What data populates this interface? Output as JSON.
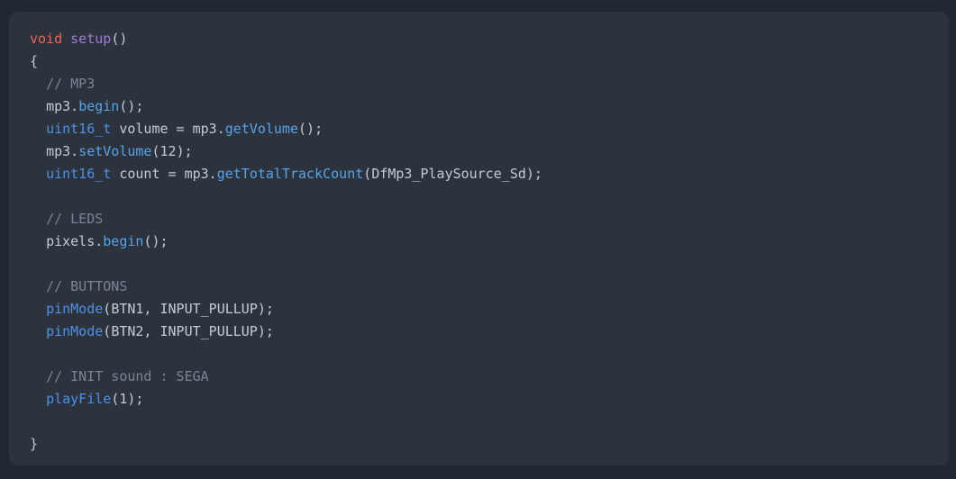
{
  "editor": {
    "background": "#222831",
    "panel_background": "#2d333d",
    "language": "cpp",
    "font_size_px": 15,
    "line_height_px": 25,
    "indent_spaces": 2,
    "colors": {
      "plain": "#c5cbd4",
      "keyword": "#e9645c",
      "type": "#4d91e8",
      "function_definition": "#9b7fd4",
      "function_call": "#4d91e8",
      "method_call": "#56a3ea",
      "comment": "#7a8494",
      "number": "#c5cbd4",
      "punctuation": "#c5cbd4"
    }
  },
  "code": {
    "lines": [
      {
        "number": 1,
        "indent": 0,
        "text": "void setup()",
        "tokens": [
          {
            "text": "void",
            "type": "keyword"
          },
          {
            "text": " ",
            "type": "plain"
          },
          {
            "text": "setup",
            "type": "fndef"
          },
          {
            "text": "()",
            "type": "punct"
          }
        ]
      },
      {
        "number": 2,
        "indent": 0,
        "text": "{",
        "tokens": [
          {
            "text": "{",
            "type": "punct"
          }
        ]
      },
      {
        "number": 3,
        "indent": 2,
        "text": "// MP3",
        "tokens": [
          {
            "text": "// MP3",
            "type": "comment"
          }
        ]
      },
      {
        "number": 4,
        "indent": 2,
        "text": "mp3.begin();",
        "tokens": [
          {
            "text": "mp3.",
            "type": "plain"
          },
          {
            "text": "begin",
            "type": "method"
          },
          {
            "text": "();",
            "type": "punct"
          }
        ]
      },
      {
        "number": 5,
        "indent": 2,
        "text": "uint16_t volume = mp3.getVolume();",
        "tokens": [
          {
            "text": "uint16_t",
            "type": "type"
          },
          {
            "text": " volume = mp3.",
            "type": "plain"
          },
          {
            "text": "getVolume",
            "type": "method"
          },
          {
            "text": "();",
            "type": "punct"
          }
        ]
      },
      {
        "number": 6,
        "indent": 2,
        "text": "mp3.setVolume(12);",
        "tokens": [
          {
            "text": "mp3.",
            "type": "plain"
          },
          {
            "text": "setVolume",
            "type": "method"
          },
          {
            "text": "(",
            "type": "punct"
          },
          {
            "text": "12",
            "type": "num"
          },
          {
            "text": ");",
            "type": "punct"
          }
        ]
      },
      {
        "number": 7,
        "indent": 2,
        "text": "uint16_t count = mp3.getTotalTrackCount(DfMp3_PlaySource_Sd);",
        "tokens": [
          {
            "text": "uint16_t",
            "type": "type"
          },
          {
            "text": " count = mp3.",
            "type": "plain"
          },
          {
            "text": "getTotalTrackCount",
            "type": "method"
          },
          {
            "text": "(",
            "type": "punct"
          },
          {
            "text": "DfMp3_PlaySource_Sd",
            "type": "plain"
          },
          {
            "text": ");",
            "type": "punct"
          }
        ]
      },
      {
        "number": 8,
        "indent": 0,
        "text": "",
        "tokens": []
      },
      {
        "number": 9,
        "indent": 2,
        "text": "// LEDS",
        "tokens": [
          {
            "text": "// LEDS",
            "type": "comment"
          }
        ]
      },
      {
        "number": 10,
        "indent": 2,
        "text": "pixels.begin();",
        "tokens": [
          {
            "text": "pixels.",
            "type": "plain"
          },
          {
            "text": "begin",
            "type": "method"
          },
          {
            "text": "();",
            "type": "punct"
          }
        ]
      },
      {
        "number": 11,
        "indent": 0,
        "text": "",
        "tokens": []
      },
      {
        "number": 12,
        "indent": 2,
        "text": "// BUTTONS",
        "tokens": [
          {
            "text": "// BUTTONS",
            "type": "comment"
          }
        ]
      },
      {
        "number": 13,
        "indent": 2,
        "text": "pinMode(BTN1, INPUT_PULLUP);",
        "tokens": [
          {
            "text": "pinMode",
            "type": "fn"
          },
          {
            "text": "(",
            "type": "punct"
          },
          {
            "text": "BTN1, INPUT_PULLUP",
            "type": "plain"
          },
          {
            "text": ");",
            "type": "punct"
          }
        ]
      },
      {
        "number": 14,
        "indent": 2,
        "text": "pinMode(BTN2, INPUT_PULLUP);",
        "tokens": [
          {
            "text": "pinMode",
            "type": "fn"
          },
          {
            "text": "(",
            "type": "punct"
          },
          {
            "text": "BTN2, INPUT_PULLUP",
            "type": "plain"
          },
          {
            "text": ");",
            "type": "punct"
          }
        ]
      },
      {
        "number": 15,
        "indent": 0,
        "text": "",
        "tokens": []
      },
      {
        "number": 16,
        "indent": 2,
        "text": "// INIT sound : SEGA",
        "tokens": [
          {
            "text": "// INIT sound : SEGA",
            "type": "comment"
          }
        ]
      },
      {
        "number": 17,
        "indent": 2,
        "text": "playFile(1);",
        "tokens": [
          {
            "text": "playFile",
            "type": "fn"
          },
          {
            "text": "(",
            "type": "punct"
          },
          {
            "text": "1",
            "type": "num"
          },
          {
            "text": ");",
            "type": "punct"
          }
        ]
      },
      {
        "number": 18,
        "indent": 0,
        "text": "",
        "tokens": []
      },
      {
        "number": 19,
        "indent": 0,
        "text": "}",
        "tokens": [
          {
            "text": "}",
            "type": "punct"
          }
        ]
      }
    ]
  }
}
